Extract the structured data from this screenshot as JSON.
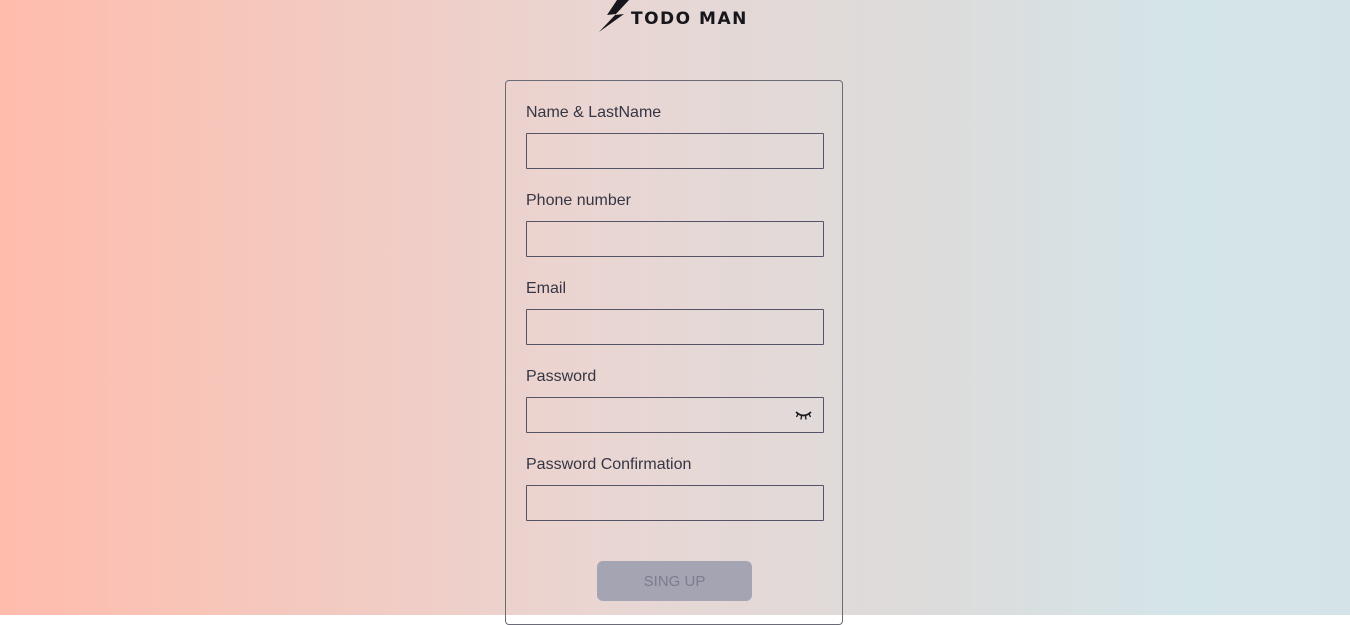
{
  "brand": {
    "name": "TODO MAN",
    "logo_icon": "lightning-bolt-icon"
  },
  "form": {
    "fields": [
      {
        "label": "Name & LastName",
        "value": "",
        "placeholder": ""
      },
      {
        "label": "Phone number",
        "value": "",
        "placeholder": ""
      },
      {
        "label": "Email",
        "value": "",
        "placeholder": ""
      },
      {
        "label": "Password",
        "value": "",
        "placeholder": "",
        "toggle_icon": "eye-closed-icon"
      },
      {
        "label": "Password Confirmation",
        "value": "",
        "placeholder": ""
      }
    ],
    "submit_label": "SING UP"
  },
  "colors": {
    "gradient_start": "#ffbcac",
    "gradient_end": "#d4e3e8",
    "button_bg": "#a4a4b3"
  }
}
